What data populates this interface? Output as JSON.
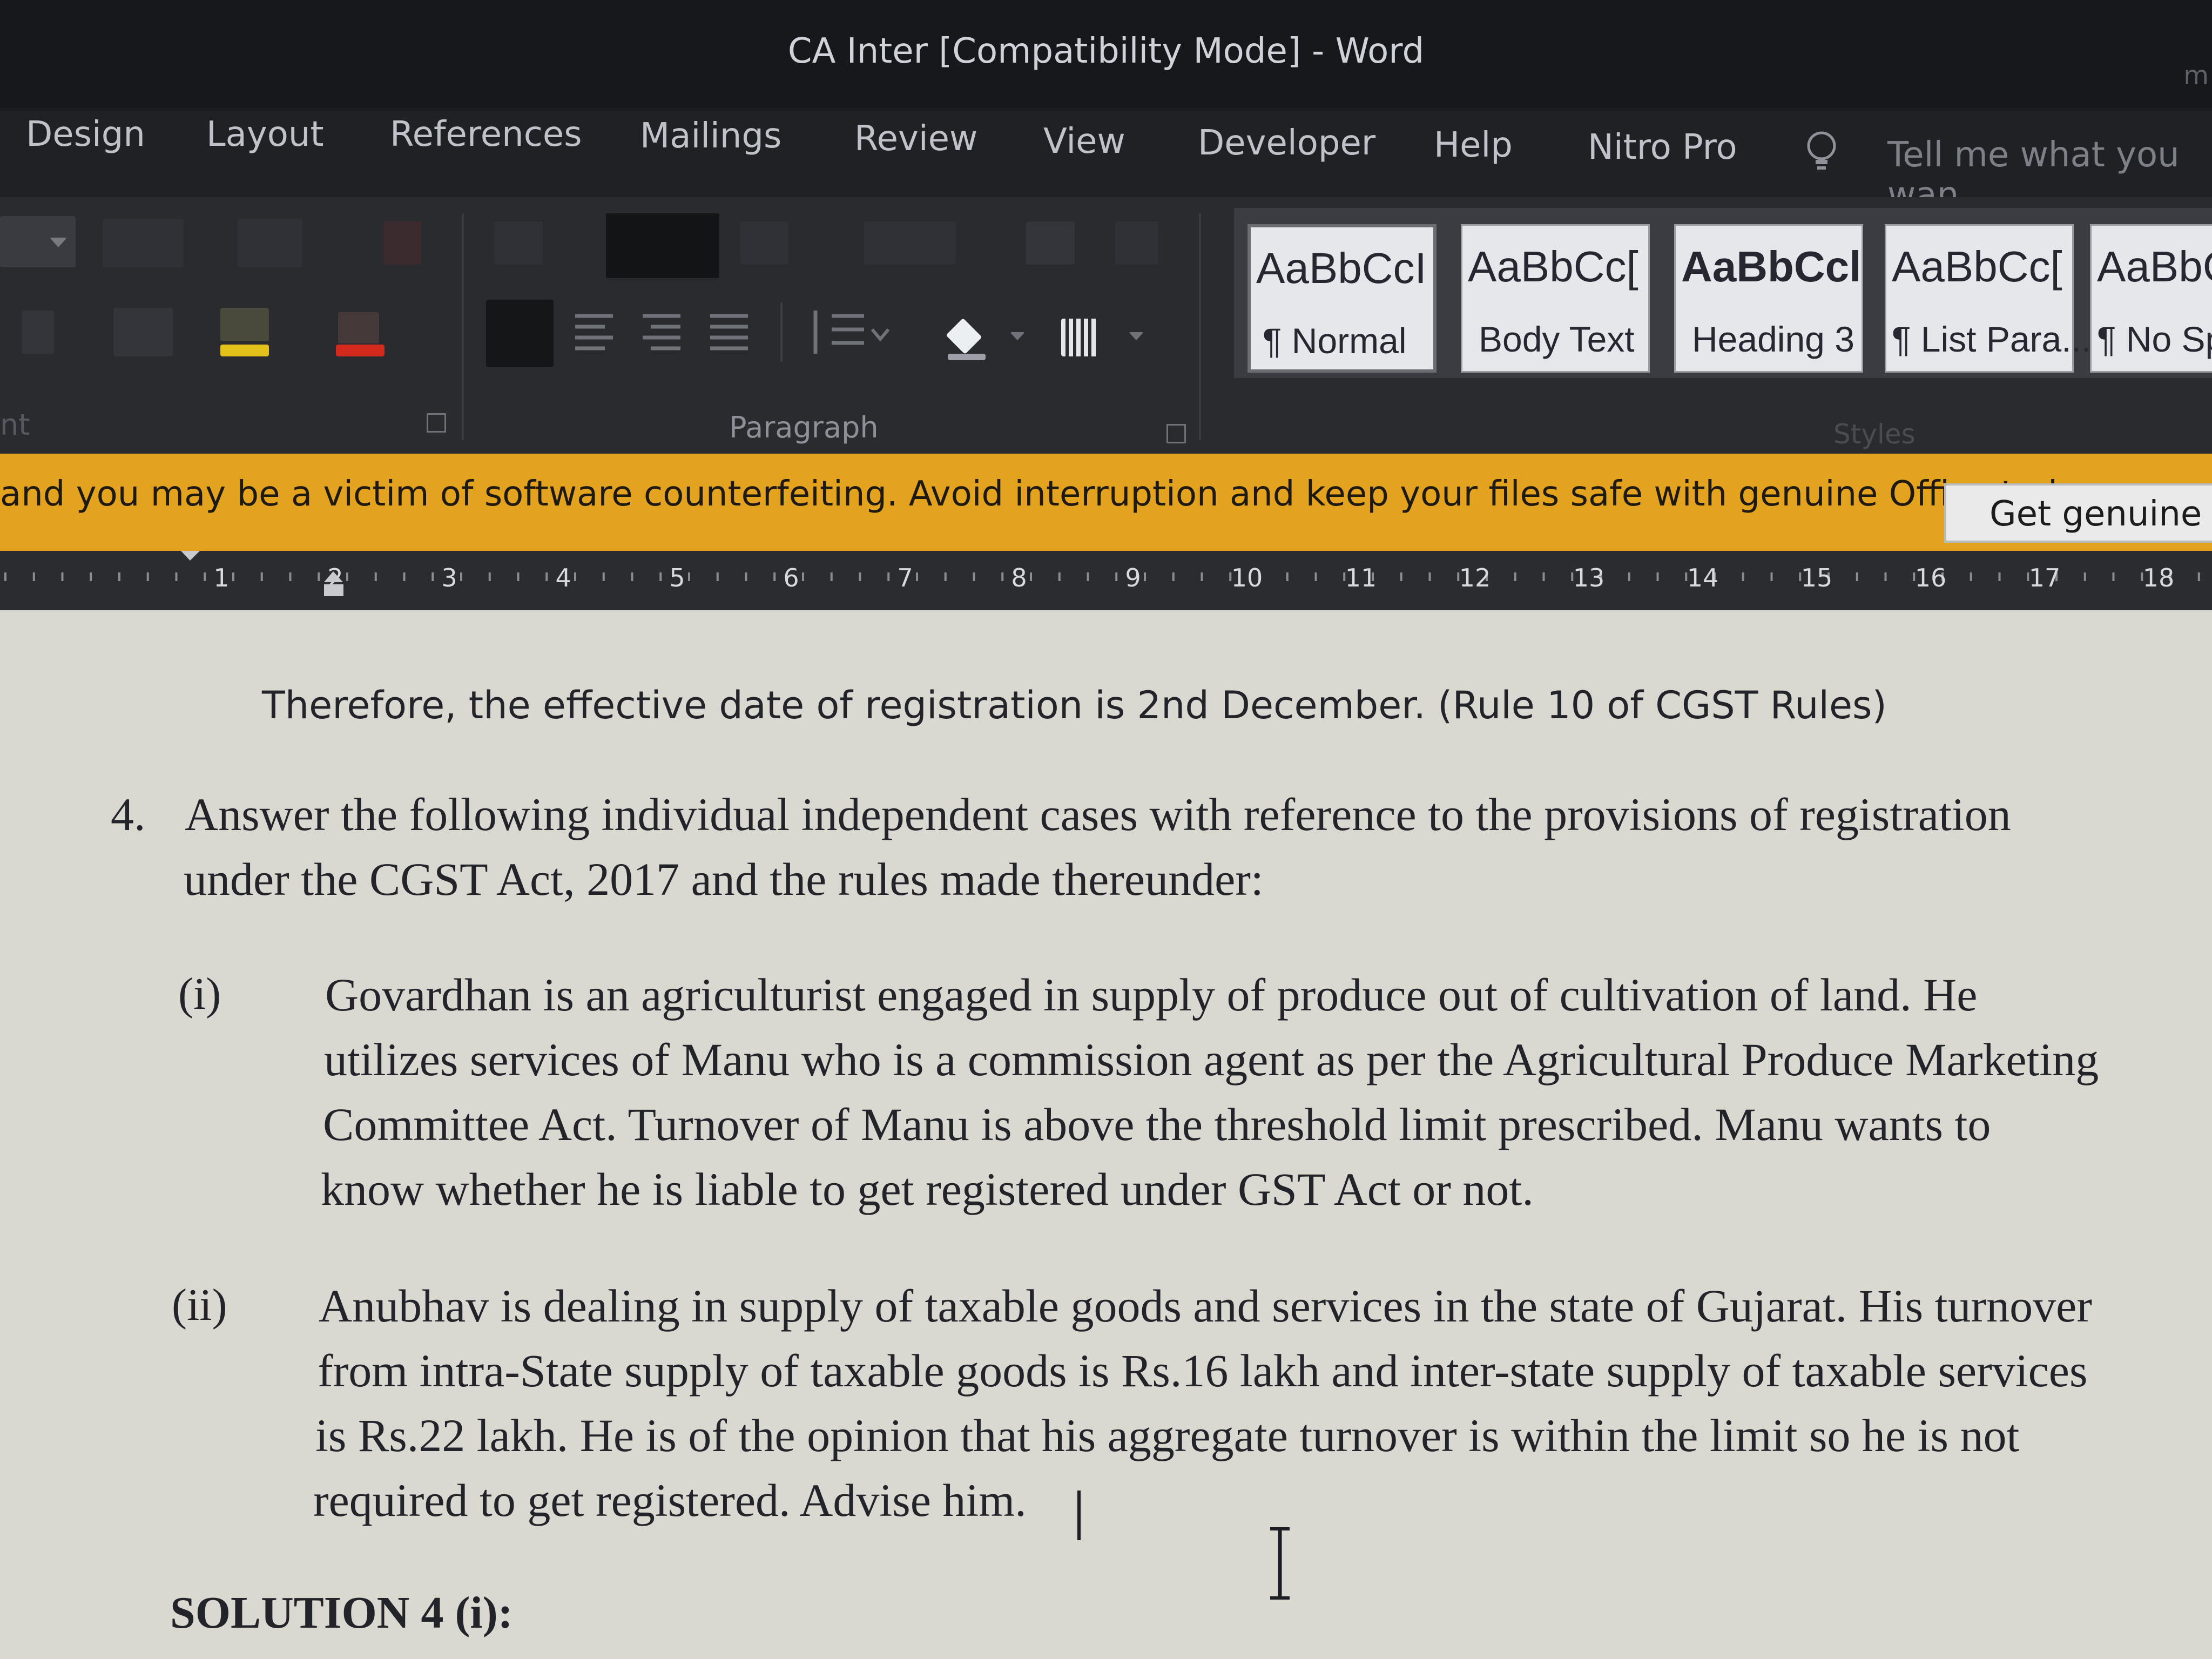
{
  "window": {
    "title": "CA Inter [Compatibility Mode]  -  Word",
    "right_glyph": "m"
  },
  "tabs": [
    "Design",
    "Layout",
    "References",
    "Mailings",
    "Review",
    "View",
    "Developer",
    "Help",
    "Nitro Pro"
  ],
  "tell_me": "Tell me what you wan",
  "ribbon": {
    "groups": {
      "font_label": "nt",
      "paragraph_label": "Paragraph",
      "styles_label": "Styles"
    },
    "colors": {
      "highlight": "#e2c21a",
      "font_color": "#d32a1e"
    },
    "styles": [
      {
        "sample": "AaBbCcI",
        "name": "¶ Normal",
        "bold": false,
        "selected": true
      },
      {
        "sample": "AaBbCc[",
        "name": "Body Text",
        "bold": false,
        "selected": false
      },
      {
        "sample": "AaBbCcl",
        "name": "Heading 3",
        "bold": true,
        "selected": false
      },
      {
        "sample": "AaBbCc[",
        "name": "¶ List Para...",
        "bold": false,
        "selected": false
      },
      {
        "sample": "AaBbC",
        "name": "¶ No Sp",
        "bold": false,
        "selected": false
      }
    ]
  },
  "activation_bar": {
    "message": "and you may be a victim of software counterfeiting. Avoid interruption and keep your files safe with genuine Office today.",
    "button": "Get genuine O"
  },
  "ruler": {
    "numbers": [
      "1",
      "2",
      "3",
      "4",
      "5",
      "6",
      "7",
      "8",
      "9",
      "10",
      "11",
      "12",
      "13",
      "14",
      "15",
      "16",
      "17",
      "18"
    ]
  },
  "document": {
    "para_prev": "Therefore, the effective date of registration is 2nd December. (Rule 10 of CGST Rules)",
    "q4": {
      "number": "4.",
      "line1": "Answer the following individual independent cases with reference to the provisions of registration",
      "line2": "under the CGST Act, 2017 and the rules made thereunder:"
    },
    "case_i": {
      "label": "(i)",
      "lines": [
        "Govardhan is an agriculturist engaged in supply of produce out of cultivation of land. He",
        "utilizes services of Manu who is a commission agent as per the Agricultural Produce Marketing",
        "Committee Act. Turnover of Manu is above the threshold limit prescribed. Manu wants to",
        "know whether he is liable to get registered under GST Act or not."
      ]
    },
    "case_ii": {
      "label": "(ii)",
      "lines": [
        "Anubhav is dealing in supply of taxable goods and services in the state of Gujarat. His turnover",
        "from intra-State supply of taxable goods is Rs.16 lakh and inter-state supply of taxable services",
        "is Rs.22 lakh. He is of the opinion that his aggregate turnover is within the limit so he is not",
        "required to get registered. Advise him."
      ]
    },
    "solution_heading": "SOLUTION 4 (i):"
  }
}
